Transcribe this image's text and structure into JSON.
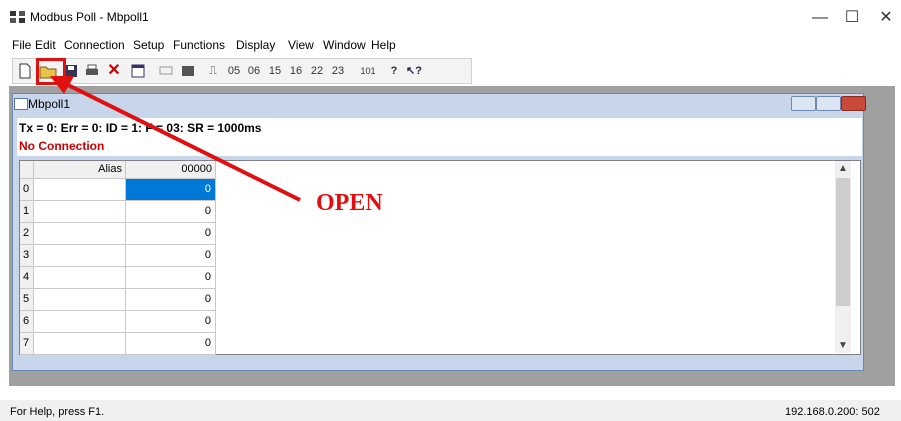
{
  "window": {
    "title": "Modbus Poll - Mbpoll1",
    "minimize": "—",
    "maximize": "☐",
    "close": "✕"
  },
  "menu": [
    "File",
    "Edit",
    "Connection",
    "Setup",
    "Functions",
    "Display",
    "View",
    "Window",
    "Help"
  ],
  "toolbar": {
    "fc_labels": [
      "05",
      "06",
      "15",
      "16",
      "22",
      "23"
    ],
    "btn_101": "101"
  },
  "child": {
    "title": "Mbpoll1",
    "status": "Tx = 0: Err = 0: ID = 1: F = 03: SR = 1000ms",
    "connection": "No Connection",
    "grid": {
      "headers": {
        "alias": "Alias",
        "col": "00000"
      },
      "rows": [
        "0",
        "1",
        "2",
        "3",
        "4",
        "5",
        "6",
        "7"
      ],
      "values": [
        "0",
        "0",
        "0",
        "0",
        "0",
        "0",
        "0",
        "0"
      ]
    }
  },
  "annotation": {
    "label": "OPEN",
    "color": "#e01010"
  },
  "statusbar": {
    "help": "For Help, press F1.",
    "address": "192.168.0.200: 502"
  },
  "colors": {
    "accent": "#e01010",
    "selection": "#0078d7",
    "child_frame": "#c7d6ea"
  }
}
